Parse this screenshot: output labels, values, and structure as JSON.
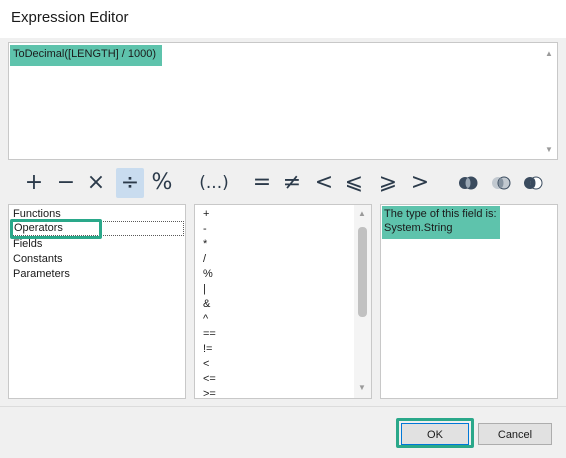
{
  "window": {
    "title": "Expression Editor"
  },
  "expression": {
    "text": "ToDecimal([LENGTH] / 1000)"
  },
  "toolbar": {
    "operators": [
      {
        "symbol": "+",
        "icon": "plus-icon"
      },
      {
        "symbol": "−",
        "icon": "minus-icon"
      },
      {
        "symbol": "×",
        "icon": "multiply-icon"
      },
      {
        "symbol": "÷",
        "icon": "divide-icon",
        "selected": true
      },
      {
        "symbol": "%",
        "icon": "percent-icon"
      },
      {
        "symbol": "(...)",
        "icon": "parentheses-icon"
      },
      {
        "symbol": "=",
        "icon": "equals-icon"
      },
      {
        "symbol": "≠",
        "icon": "not-equal-icon"
      },
      {
        "symbol": "<",
        "icon": "less-than-icon"
      },
      {
        "symbol": "⩽",
        "icon": "less-equal-icon"
      },
      {
        "symbol": "⩾",
        "icon": "greater-equal-icon"
      },
      {
        "symbol": ">",
        "icon": "greater-than-icon"
      }
    ],
    "logic_icons": [
      "and-icon",
      "or-icon",
      "not-icon"
    ]
  },
  "categories": {
    "items": [
      "Functions",
      "Operators",
      "Fields",
      "Constants",
      "Parameters"
    ],
    "selected": "Operators"
  },
  "operator_list": {
    "items": [
      "+",
      "-",
      "*",
      "/",
      "%",
      "|",
      "&",
      "^",
      "==",
      "!=",
      "<",
      "<=",
      ">="
    ]
  },
  "info": {
    "line1": "The type of this field is:",
    "line2": "System.String"
  },
  "buttons": {
    "ok": "OK",
    "cancel": "Cancel"
  },
  "colors": {
    "highlight": "#5ec3ac",
    "callout_border": "#2aa88a",
    "selected_op": "#c9dcef"
  }
}
